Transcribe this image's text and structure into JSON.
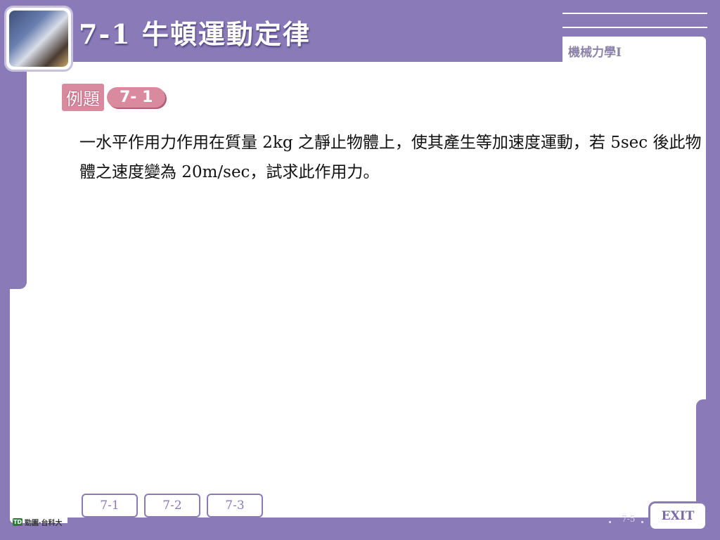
{
  "header": {
    "title": "7-1 牛頓運動定律",
    "subject": "機械力學I"
  },
  "example": {
    "label": "例題",
    "number": "7- 1"
  },
  "problem": {
    "text": "一水平作用力作用在質量 2kg 之靜止物體上，使其產生等加速度運動，若 5sec 後此物體之速度變為 20m/sec，試求此作用力。"
  },
  "nav": {
    "buttons": [
      "7-1",
      "7-2",
      "7-3"
    ]
  },
  "footer": {
    "logo_text": "勁園‧台科大",
    "page_number": "7-5",
    "exit_label": "EXIT"
  },
  "colors": {
    "frame": "#8a7ab8",
    "example_accent": "#d98a9e"
  }
}
